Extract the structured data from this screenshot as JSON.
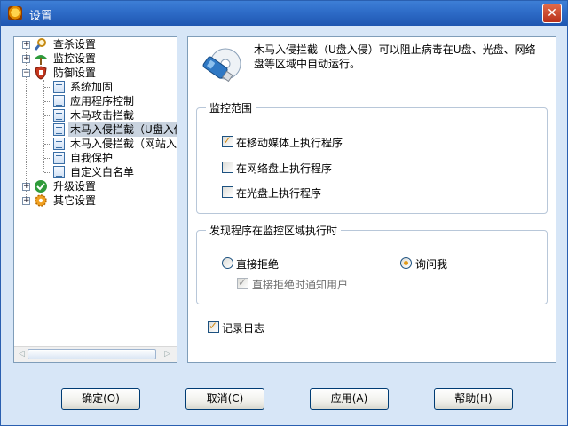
{
  "window": {
    "title": "设置"
  },
  "tree": {
    "items": [
      {
        "label": "查杀设置"
      },
      {
        "label": "监控设置"
      },
      {
        "label": "防御设置"
      },
      {
        "label": "系统加固"
      },
      {
        "label": "应用程序控制"
      },
      {
        "label": "木马攻击拦截"
      },
      {
        "label": "木马入侵拦截（U盘入侵"
      },
      {
        "label": "木马入侵拦截（网站入侵"
      },
      {
        "label": "自我保护"
      },
      {
        "label": "自定义白名单"
      },
      {
        "label": "升级设置"
      },
      {
        "label": "其它设置"
      }
    ]
  },
  "panel": {
    "description": "木马入侵拦截（U盘入侵）可以阻止病毒在U盘、光盘、网络盘等区域中自动运行。",
    "monitor_group": {
      "title": "监控范围",
      "options": [
        {
          "label": "在移动媒体上执行程序",
          "checked": true
        },
        {
          "label": "在网络盘上执行程序",
          "checked": false
        },
        {
          "label": "在光盘上执行程序",
          "checked": false
        }
      ]
    },
    "action_group": {
      "title": "发现程序在监控区域执行时",
      "radio_block": "直接拒绝",
      "radio_ask": "询问我",
      "notify_label": "直接拒绝时通知用户"
    },
    "log_label": "记录日志"
  },
  "buttons": {
    "ok": "确定(O)",
    "cancel": "取消(C)",
    "apply": "应用(A)",
    "help": "帮助(H)"
  }
}
